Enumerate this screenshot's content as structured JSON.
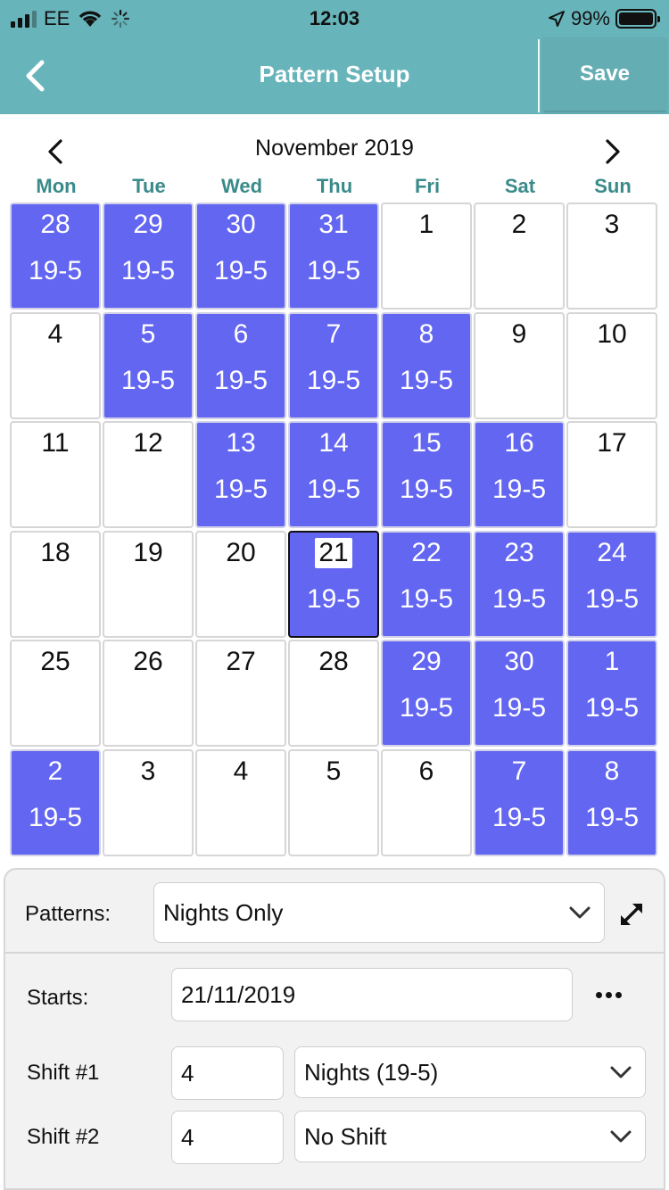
{
  "status_bar": {
    "carrier": "EE",
    "time": "12:03",
    "battery": "99%",
    "battery_level": 0.99
  },
  "nav": {
    "title": "Pattern Setup",
    "save_label": "Save"
  },
  "calendar": {
    "month": "November 2019",
    "weekdays": [
      "Mon",
      "Tue",
      "Wed",
      "Thu",
      "Fri",
      "Sat",
      "Sun"
    ],
    "cells": [
      {
        "day": "28",
        "label": "19-5"
      },
      {
        "day": "29",
        "label": "19-5"
      },
      {
        "day": "30",
        "label": "19-5"
      },
      {
        "day": "31",
        "label": "19-5"
      },
      {
        "day": "1",
        "label": ""
      },
      {
        "day": "2",
        "label": ""
      },
      {
        "day": "3",
        "label": ""
      },
      {
        "day": "4",
        "label": ""
      },
      {
        "day": "5",
        "label": "19-5"
      },
      {
        "day": "6",
        "label": "19-5"
      },
      {
        "day": "7",
        "label": "19-5"
      },
      {
        "day": "8",
        "label": "19-5"
      },
      {
        "day": "9",
        "label": ""
      },
      {
        "day": "10",
        "label": ""
      },
      {
        "day": "11",
        "label": ""
      },
      {
        "day": "12",
        "label": ""
      },
      {
        "day": "13",
        "label": "19-5"
      },
      {
        "day": "14",
        "label": "19-5"
      },
      {
        "day": "15",
        "label": "19-5"
      },
      {
        "day": "16",
        "label": "19-5"
      },
      {
        "day": "17",
        "label": ""
      },
      {
        "day": "18",
        "label": ""
      },
      {
        "day": "19",
        "label": ""
      },
      {
        "day": "20",
        "label": ""
      },
      {
        "day": "21",
        "label": "19-5",
        "today": true
      },
      {
        "day": "22",
        "label": "19-5"
      },
      {
        "day": "23",
        "label": "19-5"
      },
      {
        "day": "24",
        "label": "19-5"
      },
      {
        "day": "25",
        "label": ""
      },
      {
        "day": "26",
        "label": ""
      },
      {
        "day": "27",
        "label": ""
      },
      {
        "day": "28",
        "label": ""
      },
      {
        "day": "29",
        "label": "19-5"
      },
      {
        "day": "30",
        "label": "19-5"
      },
      {
        "day": "1",
        "label": "19-5"
      },
      {
        "day": "2",
        "label": "19-5"
      },
      {
        "day": "3",
        "label": ""
      },
      {
        "day": "4",
        "label": ""
      },
      {
        "day": "5",
        "label": ""
      },
      {
        "day": "6",
        "label": ""
      },
      {
        "day": "7",
        "label": "19-5"
      },
      {
        "day": "8",
        "label": "19-5"
      }
    ]
  },
  "form": {
    "patterns_label": "Patterns:",
    "pattern_value": "Nights Only",
    "starts_label": "Starts:",
    "starts_value": "21/11/2019",
    "shift1_label": "Shift #1",
    "shift1_count": "4",
    "shift1_value": "Nights (19-5)",
    "shift2_label": "Shift #2",
    "shift2_count": "4",
    "shift2_value": "No Shift"
  },
  "colors": {
    "header": "#67b4ba",
    "shift_fill": "#6366f1",
    "weekday_text": "#3a8a8a"
  },
  "icons": [
    "signal-icon",
    "wifi-icon",
    "loading-icon",
    "location-icon",
    "battery-icon",
    "back-chevron-icon",
    "chevron-left-icon",
    "chevron-right-icon",
    "chevron-down-icon",
    "expand-icon",
    "more-icon"
  ]
}
